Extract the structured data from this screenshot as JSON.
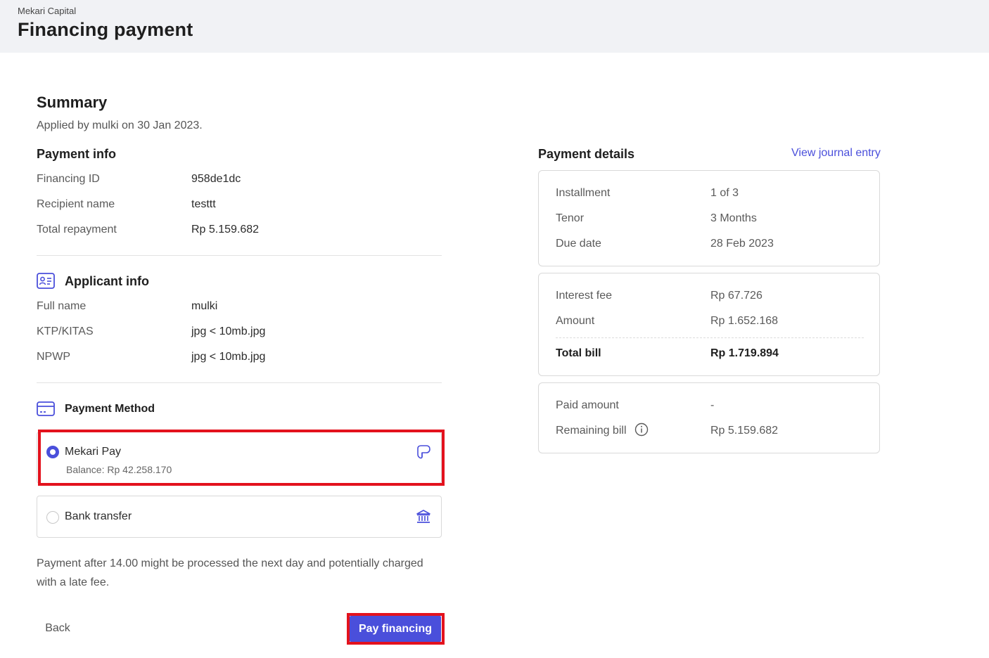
{
  "header": {
    "breadcrumb": "Mekari Capital",
    "title": "Financing payment"
  },
  "summary": {
    "title": "Summary",
    "applied": "Applied by mulki on 30 Jan 2023."
  },
  "payment_info": {
    "title": "Payment info",
    "rows": [
      {
        "label": "Financing ID",
        "value": "958de1dc"
      },
      {
        "label": "Recipient name",
        "value": "testtt"
      },
      {
        "label": "Total repayment",
        "value": "Rp 5.159.682"
      }
    ]
  },
  "applicant_info": {
    "title": "Applicant info",
    "icon": "id-card-icon",
    "rows": [
      {
        "label": "Full name",
        "value": "mulki"
      },
      {
        "label": "KTP/KITAS",
        "value": "jpg < 10mb.jpg"
      },
      {
        "label": "NPWP",
        "value": "jpg < 10mb.jpg"
      }
    ]
  },
  "payment_method": {
    "title": "Payment Method",
    "icon": "credit-card-icon",
    "options": [
      {
        "label": "Mekari Pay",
        "sub": "Balance: Rp 42.258.170",
        "selected": true,
        "icon": "mekari-pay-icon"
      },
      {
        "label": "Bank transfer",
        "selected": false,
        "icon": "bank-icon"
      }
    ]
  },
  "note": "Payment after 14.00 might be processed the next day and potentially charged with a late fee.",
  "actions": {
    "back": "Back",
    "pay": "Pay financing"
  },
  "payment_details": {
    "title": "Payment details",
    "link": "View journal entry",
    "card1": [
      {
        "label": "Installment",
        "value": "1 of 3"
      },
      {
        "label": "Tenor",
        "value": "3 Months"
      },
      {
        "label": "Due date",
        "value": "28 Feb 2023"
      }
    ],
    "card2": [
      {
        "label": "Interest fee",
        "value": "Rp 67.726"
      },
      {
        "label": "Amount",
        "value": "Rp 1.652.168"
      }
    ],
    "total": {
      "label": "Total bill",
      "value": "Rp 1.719.894"
    },
    "card3": [
      {
        "label": "Paid amount",
        "value": "-"
      },
      {
        "label": "Remaining bill",
        "value": "Rp 5.159.682"
      }
    ]
  },
  "colors": {
    "accent": "#4a4fdb",
    "highlight": "#e3121d",
    "header_bg": "#f1f2f5"
  }
}
